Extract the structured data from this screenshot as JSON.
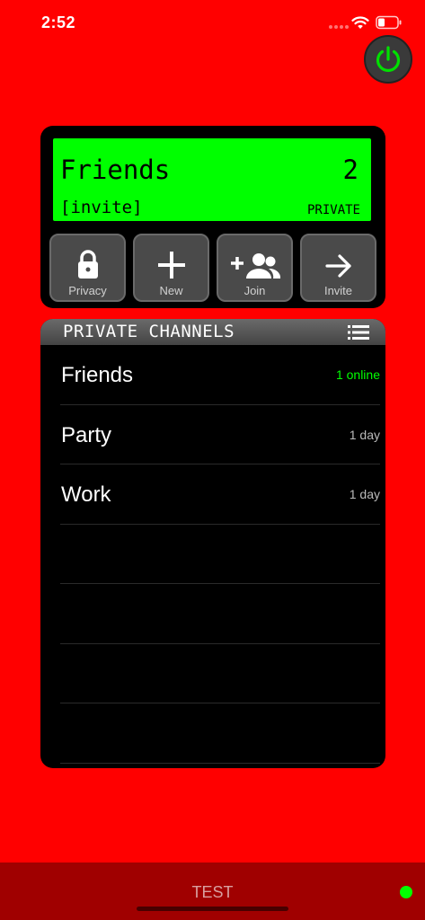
{
  "status_bar": {
    "time": "2:52"
  },
  "lcd": {
    "channel_name": "Friends",
    "count": "2",
    "invite_code": "[invite]",
    "type": "PRIVATE"
  },
  "actions": [
    {
      "label": "Privacy",
      "icon": "lock-icon"
    },
    {
      "label": "New",
      "icon": "plus-icon"
    },
    {
      "label": "Join",
      "icon": "add-group-icon"
    },
    {
      "label": "Invite",
      "icon": "arrow-right-icon"
    }
  ],
  "channels": {
    "title": "PRIVATE CHANNELS",
    "items": [
      {
        "name": "Friends",
        "status": "1 online"
      },
      {
        "name": "Party",
        "status": "1 day"
      },
      {
        "name": "Work",
        "status": "1 day"
      }
    ]
  },
  "bottom_bar": {
    "label": "TEST"
  },
  "colors": {
    "background": "#ff0000",
    "lcd": "#00ff00",
    "online": "#00ff00",
    "bottom_bar": "#a00000"
  }
}
